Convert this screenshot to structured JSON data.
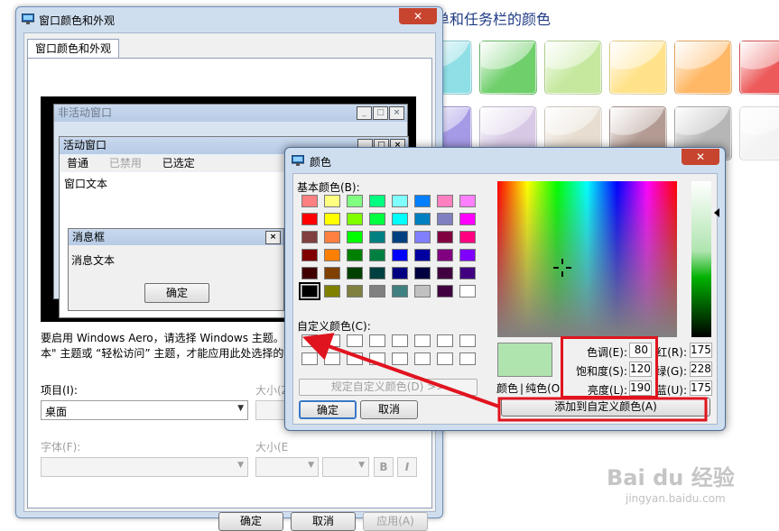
{
  "background": {
    "title": "单和任务栏的颜色",
    "swatch_colors": [
      [
        "#8edfe6",
        "#6fcf6b",
        "#c5e89e",
        "#ffe28a",
        "#ffb866",
        "#ec5a5a",
        "#f07fc0"
      ],
      [
        "#a59ae6",
        "#d7c8e5",
        "#e7ddd0",
        "#b39b93",
        "#b6b6b6",
        "#f3f3f3",
        ""
      ]
    ]
  },
  "appearance_dialog": {
    "title": "窗口颜色和外观",
    "close_icon": "✕",
    "tab_label": "窗口颜色和外观",
    "preview": {
      "inactive_title": "非活动窗口",
      "active_title": "活动窗口",
      "menu": {
        "normal": "普通",
        "disabled": "已禁用",
        "selected": "已选定"
      },
      "window_text": "窗口文本",
      "msgbox_title": "消息框",
      "msgbox_text": "消息文本",
      "msgbox_ok": "确定"
    },
    "info_line1": "要启用 Windows Aero，请选择 Windows 主题。",
    "info_line2": "本\" 主题或 “轻松访问” 主题，才能应用此处选择的",
    "item_label": "项目(I):",
    "item_value": "桌面",
    "size_label": "大小(Z",
    "font_label": "字体(F):",
    "size2_label": "大小(E",
    "bold_btn": "B",
    "italic_btn": "I",
    "buttons": {
      "ok": "确定",
      "cancel": "取消",
      "apply": "应用(A)"
    }
  },
  "color_dialog": {
    "title": "颜色",
    "close_icon": "✕",
    "basic_colors_label": "基本颜色(B):",
    "basic_colors": [
      [
        "#ff8080",
        "#ffff80",
        "#80ff80",
        "#00ff80",
        "#80ffff",
        "#0080ff",
        "#ff80c0",
        "#ff80ff"
      ],
      [
        "#ff0000",
        "#ffff00",
        "#80ff00",
        "#00ff40",
        "#00ffff",
        "#0080c0",
        "#8080c0",
        "#ff00ff"
      ],
      [
        "#804040",
        "#ff8040",
        "#00ff00",
        "#008080",
        "#004080",
        "#8080ff",
        "#800040",
        "#ff0080"
      ],
      [
        "#800000",
        "#ff8000",
        "#008000",
        "#008040",
        "#0000ff",
        "#0000a0",
        "#800080",
        "#8000ff"
      ],
      [
        "#400000",
        "#804000",
        "#004000",
        "#004040",
        "#000080",
        "#000040",
        "#400040",
        "#400080"
      ],
      [
        "#000000",
        "#808000",
        "#808040",
        "#808080",
        "#408080",
        "#c0c0c0",
        "#400040",
        "#ffffff"
      ]
    ],
    "custom_colors_label": "自定义颜色(C):",
    "define_button": "规定自定义颜色(D) >>",
    "ok": "确定",
    "cancel": "取消",
    "color_label": "颜色",
    "solid_label": "纯色(O)",
    "hue_label": "色调(E):",
    "hue": "80",
    "sat_label": "饱和度(S):",
    "sat": "120",
    "lum_label": "亮度(L):",
    "lum": "190",
    "red_label": "红(R):",
    "red": "175",
    "green_label": "绿(G):",
    "green": "228",
    "blue_label": "蓝(U):",
    "blue": "175",
    "add_button": "添加到自定义颜色(A)",
    "preview_color": "#afe4af",
    "annotation_color": "#e0141f"
  },
  "watermark": {
    "text": "Bai du 经验",
    "url": "jingyan.baidu.com"
  }
}
